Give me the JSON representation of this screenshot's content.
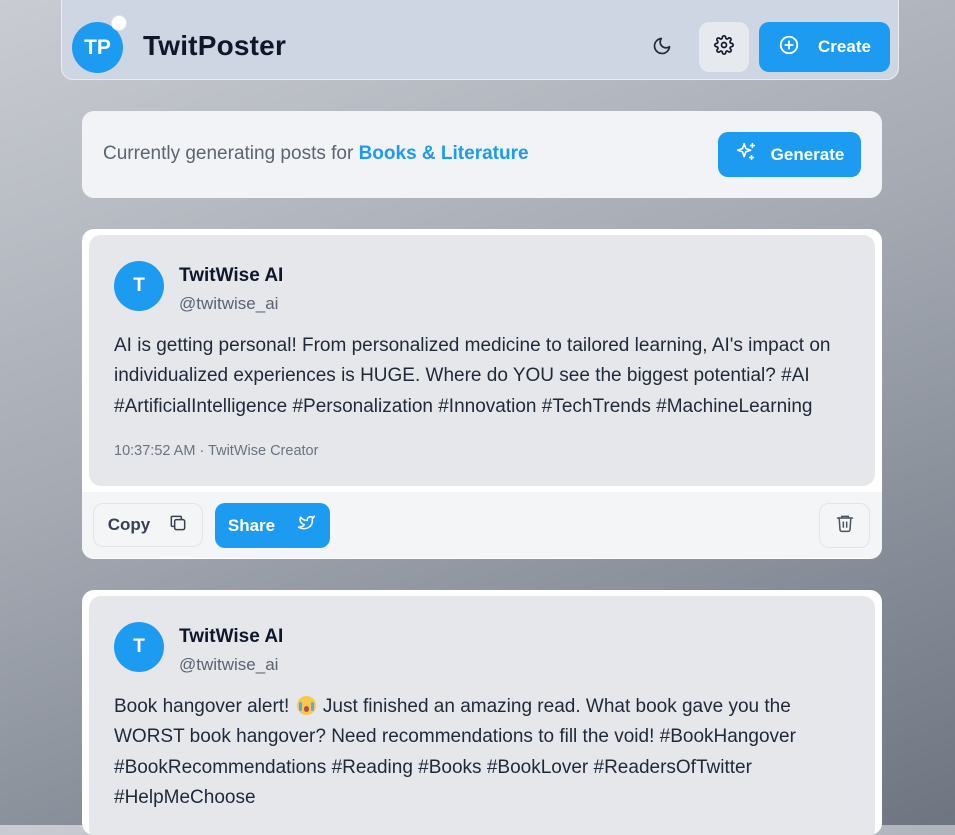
{
  "app": {
    "logo_initials": "TP",
    "title": "TwitPoster",
    "create_label": "Create",
    "accent_color": "#1d9bf0"
  },
  "generator": {
    "prefix": "Currently generating posts for ",
    "topic": "Books & Literature",
    "generate_label": "Generate"
  },
  "posts": [
    {
      "avatar_initial": "T",
      "author_name": "TwitWise AI",
      "author_handle": "@twitwise_ai",
      "body": "AI is getting personal! From personalized medicine to tailored learning, AI's impact on individualized experiences is HUGE. Where do YOU see the biggest potential? #AI #ArtificialIntelligence #Personalization #Innovation #TechTrends #MachineLearning",
      "meta": "10:37:52 AM · TwitWise Creator",
      "copy_label": "Copy",
      "share_label": "Share"
    },
    {
      "avatar_initial": "T",
      "author_name": "TwitWise AI",
      "author_handle": "@twitwise_ai",
      "body_before_emoji": "Book hangover alert! ",
      "emoji_icon": "crying-face-emoji",
      "body_after_emoji": " Just finished an amazing read. What book gave you the WORST book hangover? Need recommendations to fill the void! #BookHangover #BookRecommendations #Reading #Books #BookLover #ReadersOfTwitter #HelpMeChoose"
    }
  ],
  "icons": {
    "theme": "moon-icon",
    "settings": "gear-icon",
    "create": "plus-circle-icon",
    "generate": "sparkles-icon",
    "copy": "copy-icon",
    "share": "twitter-bird-icon",
    "delete": "trash-icon"
  }
}
